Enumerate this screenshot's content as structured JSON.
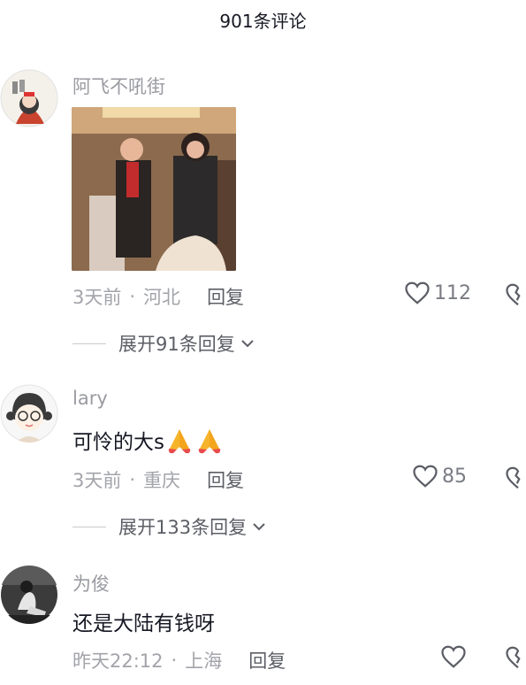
{
  "header": {
    "title": "901条评论"
  },
  "comments": [
    {
      "username": "阿飞不吼街",
      "text": "",
      "time": "3天前",
      "location": "河北",
      "reply_label": "回复",
      "likes": "112",
      "expand_label": "展开91条回复",
      "has_media": true
    },
    {
      "username": "lary",
      "text": "可怜的大s",
      "emoji": "folded-hands x2",
      "time": "3天前",
      "location": "重庆",
      "reply_label": "回复",
      "likes": "85",
      "expand_label": "展开133条回复"
    },
    {
      "username": "为俊",
      "text": "还是大陆有钱呀",
      "time": "昨天22:12",
      "location": "上海",
      "reply_label": "回复",
      "likes": ""
    }
  ],
  "icons": {
    "like": "heart-outline-icon",
    "dislike": "broken-heart-icon",
    "expand": "chevron-down-icon"
  },
  "colors": {
    "text": "#161823",
    "meta": "#a3a4aa",
    "username": "#9a9ba1"
  }
}
